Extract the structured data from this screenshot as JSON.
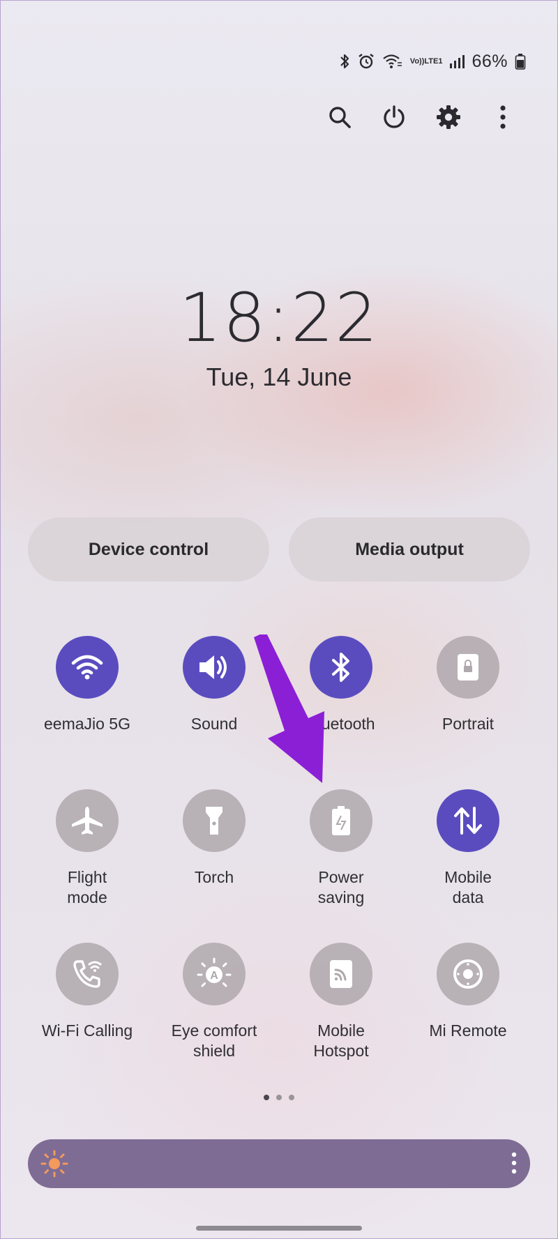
{
  "status_bar": {
    "icons": [
      "bluetooth-icon",
      "alarm-icon",
      "wifi-calling-icon",
      "volte-icon",
      "signal-icon",
      "battery-icon"
    ],
    "volte_top": "Vo))",
    "volte_bottom": "LTE1",
    "battery_percent": "66%"
  },
  "top_actions": {
    "icons": [
      "search-icon",
      "power-icon",
      "settings-icon",
      "more-icon"
    ]
  },
  "clock": {
    "time": "18:22",
    "date": "Tue, 14 June"
  },
  "buttons": {
    "device_control": "Device control",
    "media_output": "Media output"
  },
  "tiles": [
    {
      "label": "eemaJio 5G",
      "icon": "wifi-icon",
      "state": "on"
    },
    {
      "label": "Sound",
      "icon": "volume-icon",
      "state": "on"
    },
    {
      "label": "Bluetooth",
      "icon": "bluetooth-icon",
      "state": "on"
    },
    {
      "label": "Portrait",
      "icon": "portrait-lock-icon",
      "state": "off"
    },
    {
      "label_line1": "Flight",
      "label_line2": "mode",
      "icon": "airplane-icon",
      "state": "off"
    },
    {
      "label": "Torch",
      "icon": "flashlight-icon",
      "state": "off"
    },
    {
      "label_line1": "Power",
      "label_line2": "saving",
      "icon": "battery-saver-icon",
      "state": "off"
    },
    {
      "label_line1": "Mobile",
      "label_line2": "data",
      "icon": "data-transfer-icon",
      "state": "on"
    },
    {
      "label": "Wi-Fi Calling",
      "icon": "wifi-calling-icon",
      "state": "off"
    },
    {
      "label_line1": "Eye comfort",
      "label_line2": "shield",
      "icon": "eye-comfort-icon",
      "state": "off"
    },
    {
      "label_line1": "Mobile",
      "label_line2": "Hotspot",
      "icon": "hotspot-icon",
      "state": "off"
    },
    {
      "label": "Mi Remote",
      "icon": "remote-icon",
      "state": "off"
    }
  ],
  "pager": {
    "pages": 3,
    "current": 1
  },
  "brightness": {
    "icon": "sun-icon",
    "menu_icon": "more-icon"
  },
  "colors": {
    "tile_on": "#5a4cbf",
    "tile_off": "#afa8ac",
    "brightness_bar": "#7e6c94",
    "brightness_sun": "#f39a5c",
    "annotation_arrow": "#8b1fd6"
  }
}
